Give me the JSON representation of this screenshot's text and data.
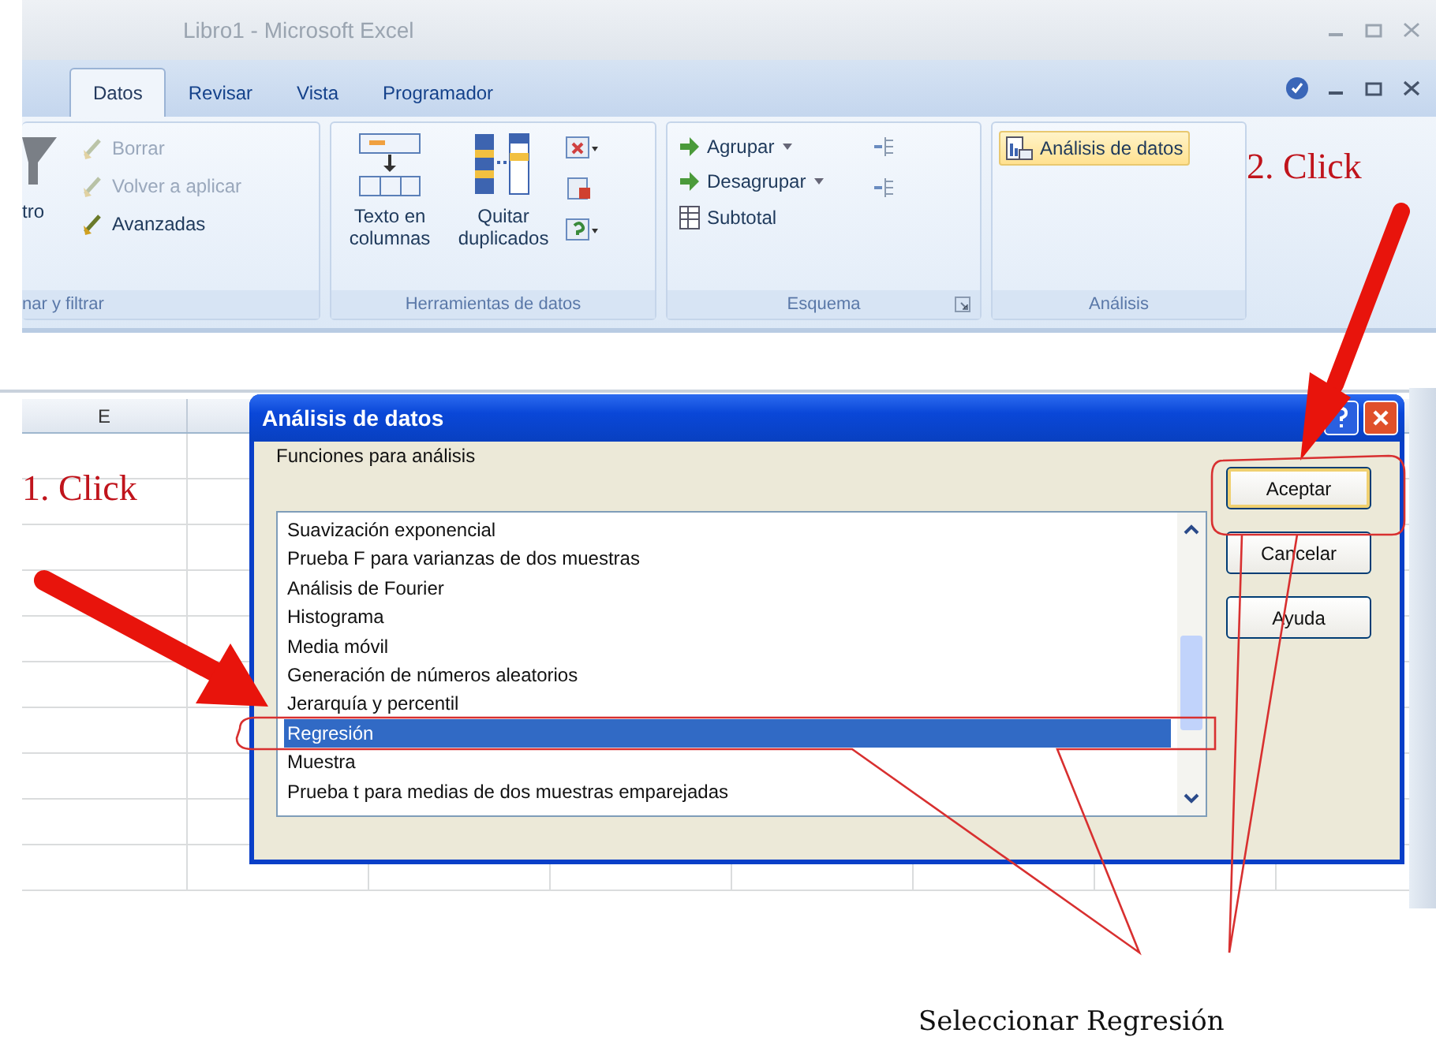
{
  "window": {
    "title": "Libro1 - Microsoft Excel"
  },
  "tabs": [
    {
      "label": "Datos",
      "selected": true
    },
    {
      "label": "Revisar",
      "selected": false
    },
    {
      "label": "Vista",
      "selected": false
    },
    {
      "label": "Programador",
      "selected": false
    }
  ],
  "ribbon": {
    "groups": [
      {
        "label": "nar y filtrar",
        "big": [
          {
            "label": "tro"
          }
        ],
        "items": [
          {
            "label": "Borrar",
            "disabled": true
          },
          {
            "label": "Volver a aplicar",
            "disabled": true
          },
          {
            "label": "Avanzadas",
            "disabled": false
          }
        ]
      },
      {
        "label": "Herramientas de datos",
        "big": [
          {
            "label": "Texto en columnas"
          },
          {
            "label": "Quitar duplicados"
          }
        ]
      },
      {
        "label": "Esquema",
        "items": [
          {
            "label": "Agrupar",
            "dropdown": true
          },
          {
            "label": "Desagrupar",
            "dropdown": true
          },
          {
            "label": "Subtotal",
            "dropdown": false
          }
        ]
      },
      {
        "label": "Análisis",
        "items": [
          {
            "label": "Análisis de datos",
            "highlighted": true
          }
        ]
      }
    ]
  },
  "grid": {
    "column_headers": [
      "E"
    ]
  },
  "dialog": {
    "title": "Análisis de datos",
    "list_label": "Funciones para análisis",
    "items": [
      {
        "label": "Suavización exponencial",
        "selected": false
      },
      {
        "label": "Prueba F para varianzas de dos muestras",
        "selected": false
      },
      {
        "label": "Análisis de Fourier",
        "selected": false
      },
      {
        "label": "Histograma",
        "selected": false
      },
      {
        "label": "Media móvil",
        "selected": false
      },
      {
        "label": "Generación de números aleatorios",
        "selected": false
      },
      {
        "label": "Jerarquía y percentil",
        "selected": false
      },
      {
        "label": "Regresión",
        "selected": true
      },
      {
        "label": "Muestra",
        "selected": false
      },
      {
        "label": "Prueba t para medias de dos muestras emparejadas",
        "selected": false
      }
    ],
    "buttons": [
      {
        "label": "Aceptar",
        "default": true
      },
      {
        "label": "Cancelar",
        "default": false
      },
      {
        "label": "Ayuda",
        "default": false
      }
    ]
  },
  "annotations": {
    "steps": [
      "1. Click",
      "2. Click"
    ],
    "caption": "Seleccionar Regresión"
  }
}
